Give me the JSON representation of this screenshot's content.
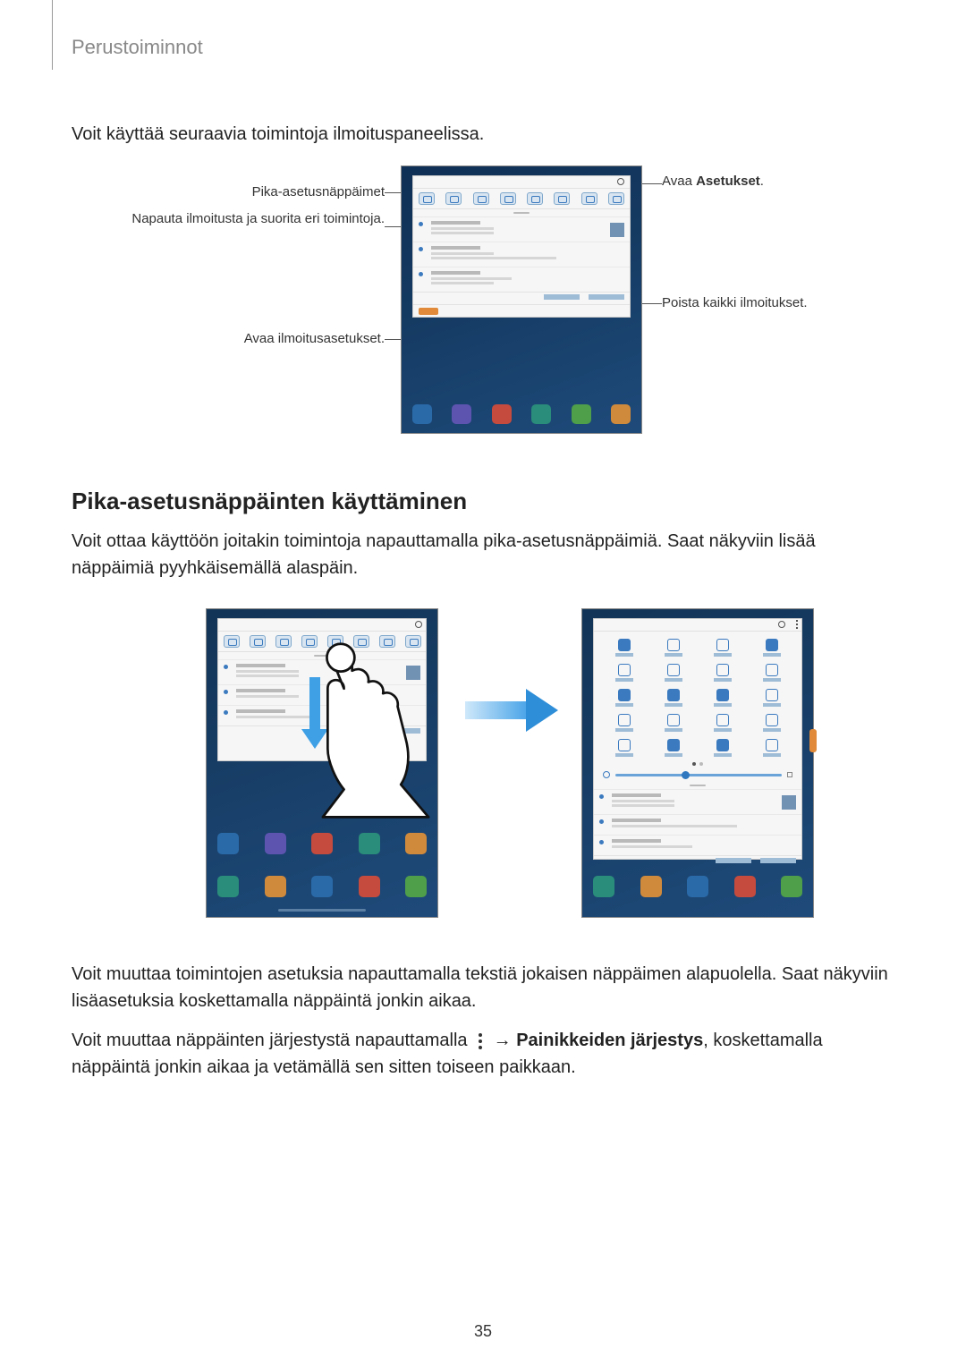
{
  "header": "Perustoiminnot",
  "intro": "Voit käyttää seuraavia toimintoja ilmoituspaneelissa.",
  "callouts": {
    "left1": "Pika-asetusnäppäimet",
    "left2": "Napauta ilmoitusta ja suorita eri toimintoja.",
    "left3": "Avaa ilmoitusasetukset.",
    "right1_pre": "Avaa ",
    "right1_bold": "Asetukset",
    "right1_post": ".",
    "right2": "Poista kaikki ilmoitukset."
  },
  "section_heading": "Pika-asetusnäppäinten käyttäminen",
  "para1": "Voit ottaa käyttöön joitakin toimintoja napauttamalla pika-asetusnäppäimiä. Saat näkyviin lisää näppäimiä pyyhkäisemällä alaspäin.",
  "para2": "Voit muuttaa toimintojen asetuksia napauttamalla tekstiä jokaisen näppäimen alapuolella. Saat näkyviin lisäasetuksia koskettamalla näppäintä jonkin aikaa.",
  "para3_pre": "Voit muuttaa näppäinten järjestystä napauttamalla ",
  "para3_arrow": " → ",
  "para3_bold": "Painikkeiden järjestys",
  "para3_post": ", koskettamalla näppäintä jonkin aikaa ja vetämällä sen sitten toiseen paikkaan.",
  "page_number": "35"
}
